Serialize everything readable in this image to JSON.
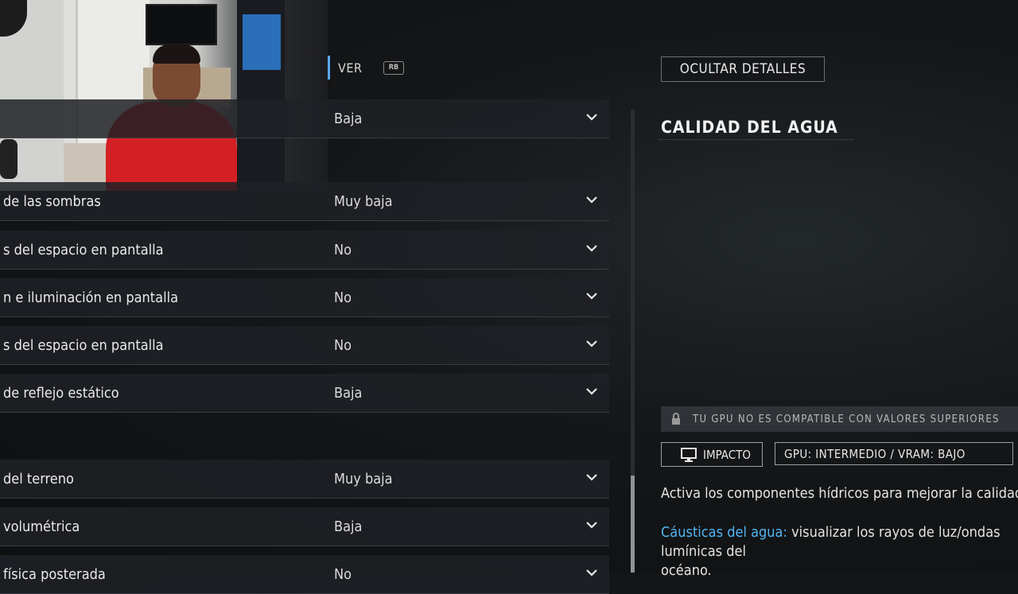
{
  "top_tab": {
    "label": "VER",
    "badge": "RB"
  },
  "settings": [
    {
      "name": "",
      "value": "Baja"
    },
    {
      "name": "de las sombras",
      "value": "Muy baja"
    },
    {
      "name": "s del espacio en pantalla",
      "value": "No"
    },
    {
      "name": "n e iluminación en pantalla",
      "value": "No"
    },
    {
      "name": "s del espacio en pantalla",
      "value": "No"
    },
    {
      "name": "de reflejo estático",
      "value": "Baja"
    },
    {
      "name": "del terreno",
      "value": "Muy baja"
    },
    {
      "name": "volumétrica",
      "value": "Baja"
    },
    {
      "name": "física posterada",
      "value": "No"
    }
  ],
  "details": {
    "hide_button": "OCULTAR DETALLES",
    "title": "CALIDAD DEL AGUA",
    "gpu_warning": "TU GPU NO ES COMPATIBLE CON VALORES SUPERIORES",
    "impact_button": "IMPACTO",
    "gpu_info": "GPU: INTERMEDIO  /  VRAM: BAJO",
    "description": "Activa los componentes hídricos para mejorar la calidad",
    "caustics_label": "Cáusticas del agua:",
    "caustics_text": " visualizar los rayos de luz/ondas lumínicas del",
    "caustics_text2": "océano."
  },
  "colors": {
    "accent": "#52b6f2",
    "tab_bar": "#5aa7ff",
    "shirt": "#d41f25"
  },
  "icons": {
    "chevron": "chevron-down-icon",
    "lock": "lock-icon",
    "monitor": "monitor-icon"
  }
}
